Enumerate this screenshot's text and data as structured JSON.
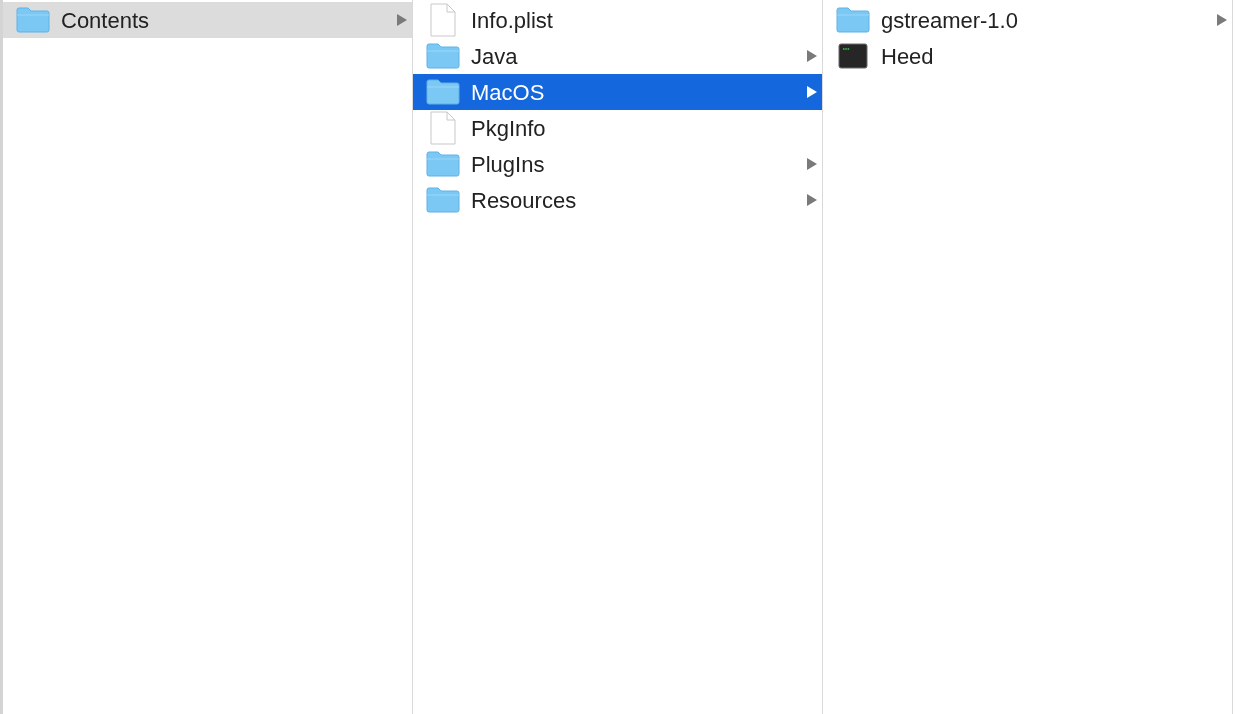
{
  "columns": [
    {
      "focused": false,
      "items": [
        {
          "name": "Contents",
          "kind": "folder",
          "selected": true,
          "expandable": true
        }
      ]
    },
    {
      "focused": true,
      "items": [
        {
          "name": "Info.plist",
          "kind": "document",
          "selected": false,
          "expandable": false
        },
        {
          "name": "Java",
          "kind": "folder",
          "selected": false,
          "expandable": true
        },
        {
          "name": "MacOS",
          "kind": "folder",
          "selected": true,
          "expandable": true
        },
        {
          "name": "PkgInfo",
          "kind": "document",
          "selected": false,
          "expandable": false
        },
        {
          "name": "PlugIns",
          "kind": "folder",
          "selected": false,
          "expandable": true
        },
        {
          "name": "Resources",
          "kind": "folder",
          "selected": false,
          "expandable": true
        }
      ]
    },
    {
      "items": [
        {
          "name": "gstreamer-1.0",
          "kind": "folder",
          "selected": false,
          "expandable": true
        },
        {
          "name": "Heed",
          "kind": "executable",
          "selected": false,
          "expandable": false
        }
      ]
    }
  ]
}
